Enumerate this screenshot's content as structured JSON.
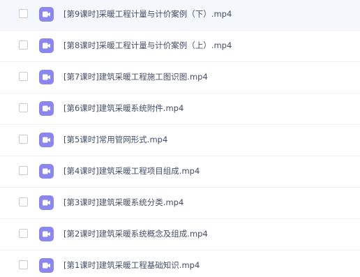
{
  "file_list": {
    "items": [
      {
        "name": "[第9课时]采暖工程计量与计价案例（下）.mp4",
        "icon": "video-icon",
        "selected": false,
        "highlighted": true
      },
      {
        "name": "[第8课时]采暖工程计量与计价案例（上）.mp4",
        "icon": "video-icon",
        "selected": false,
        "highlighted": false
      },
      {
        "name": "[第7课时]建筑采暖工程施工图识图.mp4",
        "icon": "video-icon",
        "selected": false,
        "highlighted": false
      },
      {
        "name": "[第6课时]建筑采暖系统附件.mp4",
        "icon": "video-icon",
        "selected": false,
        "highlighted": false
      },
      {
        "name": "[第5课时]常用管网形式.mp4",
        "icon": "video-icon",
        "selected": false,
        "highlighted": false
      },
      {
        "name": "[第4课时]建筑采暖工程项目组成.mp4",
        "icon": "video-icon",
        "selected": false,
        "highlighted": false
      },
      {
        "name": "[第3课时]建筑采暖系统分类.mp4",
        "icon": "video-icon",
        "selected": false,
        "highlighted": false
      },
      {
        "name": "[第2课时]建筑采暖系统概念及组成.mp4",
        "icon": "video-icon",
        "selected": false,
        "highlighted": false
      },
      {
        "name": "[第1课时]建筑采暖工程基础知识.mp4",
        "icon": "video-icon",
        "selected": false,
        "highlighted": false
      }
    ]
  },
  "colors": {
    "icon_background": "#8b87ef",
    "text": "#424e67",
    "row_highlight": "#f4f8fd"
  }
}
